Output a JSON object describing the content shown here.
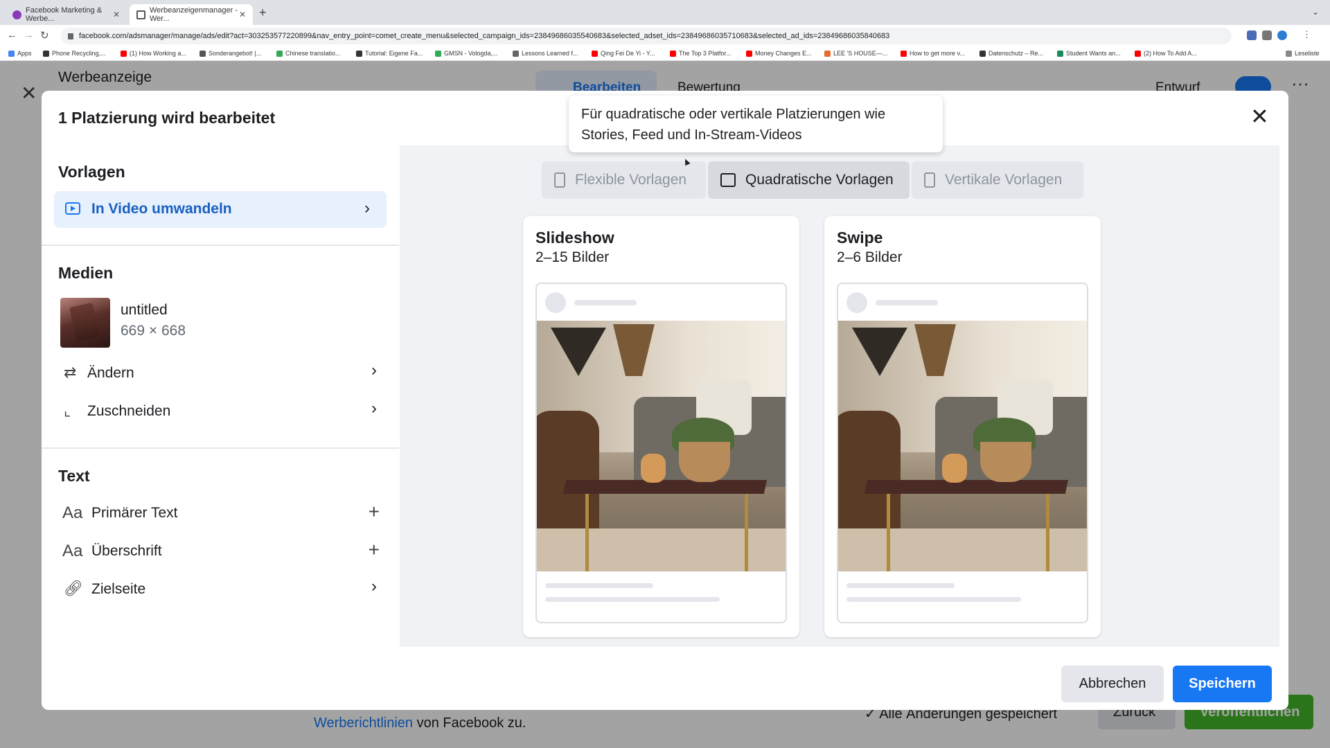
{
  "browser": {
    "tabs": [
      {
        "label": "Facebook Marketing & Werbe..."
      },
      {
        "label": "Werbeanzeigenmanager - Wer..."
      }
    ],
    "url": "facebook.com/adsmanager/manage/ads/edit?act=303253577220899&nav_entry_point=comet_create_menu&selected_campaign_ids=23849686035540683&selected_adset_ids=23849686035710683&selected_ad_ids=23849686035840683",
    "bookmarks": [
      {
        "label": "Apps",
        "color": "#4285f4"
      },
      {
        "label": "Phone Recycling,...",
        "color": "#333333"
      },
      {
        "label": "(1) How Working a...",
        "color": "#ff0000"
      },
      {
        "label": "Sonderangebot! |...",
        "color": "#555555"
      },
      {
        "label": "Chinese translatio...",
        "color": "#34a853"
      },
      {
        "label": "Tutorial: Eigene Fa...",
        "color": "#333333"
      },
      {
        "label": "GMSN - Vologda,...",
        "color": "#34a853"
      },
      {
        "label": "Lessons Learned f...",
        "color": "#666666"
      },
      {
        "label": "Qing Fei De Yi - Y...",
        "color": "#ff0000"
      },
      {
        "label": "The Top 3 Platfor...",
        "color": "#ff0000"
      },
      {
        "label": "Money Changes E...",
        "color": "#ff0000"
      },
      {
        "label": "LEE 'S HOUSE—...",
        "color": "#e86a2f"
      },
      {
        "label": "How to get more v...",
        "color": "#ff0000"
      },
      {
        "label": "Datenschutz – Re...",
        "color": "#333333"
      },
      {
        "label": "Student Wants an...",
        "color": "#1a8b5c"
      },
      {
        "label": "(2) How To Add A...",
        "color": "#ff0000"
      }
    ],
    "reading_list": "Leseliste"
  },
  "background": {
    "title": "Werbeanzeige",
    "tab_edit": "Bearbeiten",
    "tab_review": "Bewertung",
    "status": "Entwurf",
    "notice_link": "Werberichtlinien",
    "notice_text": " von Facebook zu.",
    "saved": "Alle Änderungen gespeichert",
    "back": "Zurück",
    "publish": "Veröffentlichen"
  },
  "modal": {
    "title": "1 Platzierung wird bearbeitet",
    "templates_heading": "Vorlagen",
    "convert_video": "In Video umwandeln",
    "media_heading": "Medien",
    "media_name": "untitled",
    "media_dimensions": "669 × 668",
    "change": "Ändern",
    "crop": "Zuschneiden",
    "text_heading": "Text",
    "primary_text": "Primärer Text",
    "headline": "Überschrift",
    "landing_page": "Zielseite",
    "aa_glyph": "Aa",
    "template_tabs": [
      {
        "label": "Flexible Vorlagen"
      },
      {
        "label": "Quadratische Vorlagen"
      },
      {
        "label": "Vertikale Vorlagen"
      }
    ],
    "active_template_tab": 1,
    "tooltip": "Für quadratische oder vertikale Platzierungen wie Stories, Feed und In-Stream-Videos",
    "cards": [
      {
        "title": "Slideshow",
        "subtitle": "2–15 Bilder"
      },
      {
        "title": "Swipe",
        "subtitle": "2–6 Bilder"
      }
    ],
    "cancel": "Abbrechen",
    "save": "Speichern"
  },
  "colors": {
    "accent": "#1877f2",
    "publish": "#42b72a"
  }
}
